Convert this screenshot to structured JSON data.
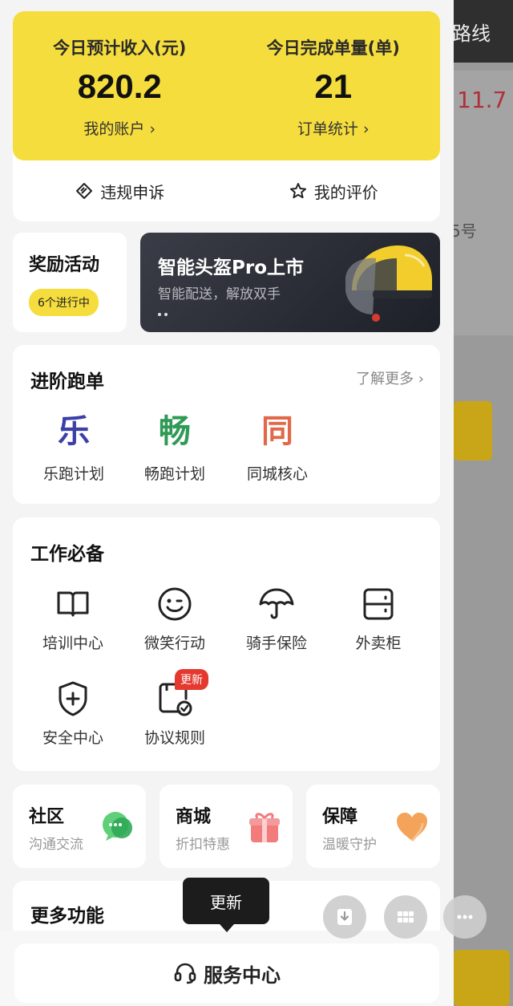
{
  "background_app": {
    "route_label": "路线",
    "value": "11.7",
    "number_suffix": "5号"
  },
  "income": {
    "today_income_label": "今日预计收入(元)",
    "today_income_value": "820.2",
    "account_link": "我的账户 ›",
    "today_orders_label": "今日完成单量(单)",
    "today_orders_value": "21",
    "order_stats_link": "订单统计 ›"
  },
  "quick_links": {
    "appeal": "违规申诉",
    "ratings": "我的评价"
  },
  "reward": {
    "title": "奖励活动",
    "badge": "6个进行中"
  },
  "banner": {
    "title": "智能头盔Pro上市",
    "subtitle": "智能配送，解放双手"
  },
  "advanced": {
    "title": "进阶跑单",
    "more": "了解更多 ›",
    "items": [
      {
        "glyph": "乐",
        "label": "乐跑计划",
        "color": "#3b3fa8"
      },
      {
        "glyph": "畅",
        "label": "畅跑计划",
        "color": "#2f9a55"
      },
      {
        "glyph": "同",
        "label": "同城核心",
        "color": "#e0694a"
      }
    ]
  },
  "work": {
    "title": "工作必备",
    "items": [
      {
        "label": "培训中心",
        "icon": "book-icon"
      },
      {
        "label": "微笑行动",
        "icon": "smile-icon"
      },
      {
        "label": "骑手保险",
        "icon": "umbrella-icon"
      },
      {
        "label": "外卖柜",
        "icon": "locker-icon"
      },
      {
        "label": "安全中心",
        "icon": "shield-icon"
      },
      {
        "label": "协议规则",
        "icon": "agreement-icon"
      }
    ],
    "new_badge": "更新"
  },
  "mini_cards": [
    {
      "title": "社区",
      "subtitle": "沟通交流",
      "icon": "chat-icon"
    },
    {
      "title": "商城",
      "subtitle": "折扣特惠",
      "icon": "gift-icon"
    },
    {
      "title": "保障",
      "subtitle": "温暖守护",
      "icon": "heart-icon"
    }
  ],
  "more_functions": {
    "title": "更多功能"
  },
  "tooltip": {
    "text": "更新"
  },
  "service": {
    "label": "服务中心"
  },
  "colors": {
    "brand_yellow": "#f5dd3d",
    "badge_red": "#e4392f"
  }
}
